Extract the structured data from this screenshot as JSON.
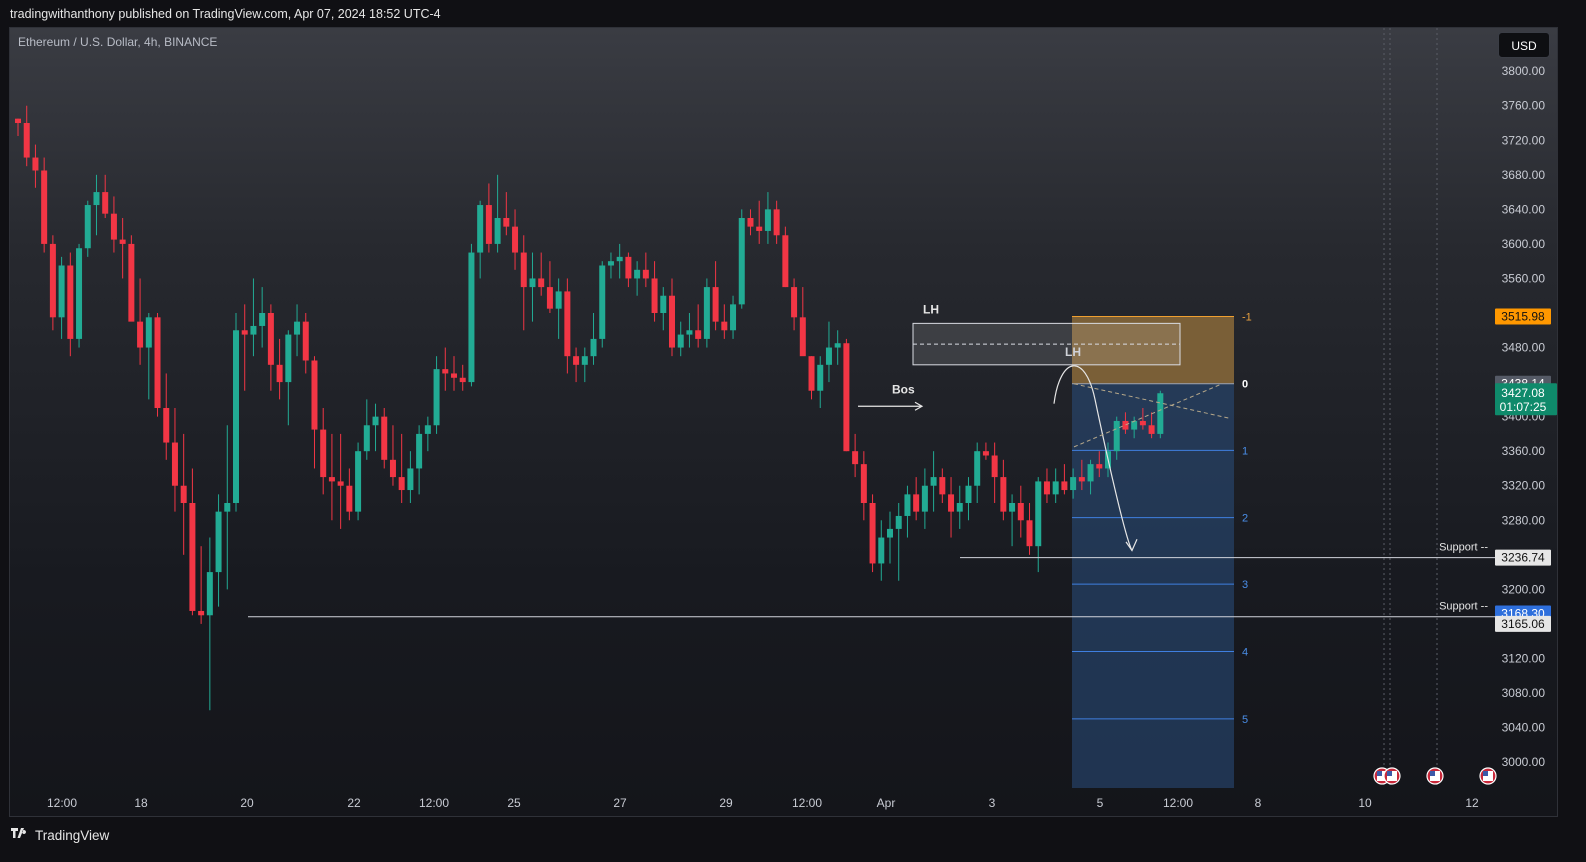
{
  "header": {
    "publish_line": "tradingwithanthony published on TradingView.com, Apr 07, 2024 18:52 UTC-4"
  },
  "chart": {
    "symbol_line": "Ethereum / U.S. Dollar, 4h, BINANCE",
    "currency_label": "USD",
    "colors": {
      "up": "#22ab94",
      "down": "#f23645",
      "support_line": "#d1d4dc",
      "target_zone": "#8a6a3a",
      "stop_zone": "#2a4e7e",
      "fib_line": "#3f7fe0",
      "price_tag_up": "#0f8a6b",
      "price_tag_blue": "#2e6fdc",
      "price_tag_orange": "#ff9800"
    }
  },
  "chart_data": {
    "type": "candlestick",
    "title": "Ethereum / U.S. Dollar, 4h, BINANCE",
    "ylim": [
      2970,
      3850
    ],
    "y_ticks": [
      "3000.00",
      "3040.00",
      "3080.00",
      "3120.00",
      "3160.00",
      "3200.00",
      "3240.00",
      "3280.00",
      "3320.00",
      "3360.00",
      "3400.00",
      "3440.00",
      "3480.00",
      "3520.00",
      "3560.00",
      "3600.00",
      "3640.00",
      "3680.00",
      "3720.00",
      "3760.00",
      "3800.00"
    ],
    "x_ticks": [
      "12:00",
      "18",
      "20",
      "22",
      "12:00",
      "25",
      "27",
      "29",
      "12:00",
      "Apr",
      "3",
      "5",
      "12:00",
      "8",
      "10",
      "12"
    ],
    "ohlc": [
      [
        3745,
        3745,
        3725,
        3740
      ],
      [
        3740,
        3760,
        3690,
        3700
      ],
      [
        3700,
        3715,
        3665,
        3685
      ],
      [
        3685,
        3700,
        3590,
        3600
      ],
      [
        3600,
        3610,
        3500,
        3515
      ],
      [
        3515,
        3585,
        3490,
        3575
      ],
      [
        3575,
        3590,
        3470,
        3490
      ],
      [
        3490,
        3600,
        3480,
        3595
      ],
      [
        3595,
        3650,
        3585,
        3645
      ],
      [
        3645,
        3680,
        3610,
        3660
      ],
      [
        3660,
        3680,
        3630,
        3635
      ],
      [
        3635,
        3655,
        3590,
        3605
      ],
      [
        3605,
        3630,
        3560,
        3600
      ],
      [
        3600,
        3610,
        3520,
        3510
      ],
      [
        3510,
        3560,
        3460,
        3480
      ],
      [
        3480,
        3520,
        3420,
        3515
      ],
      [
        3515,
        3520,
        3400,
        3410
      ],
      [
        3410,
        3450,
        3350,
        3370
      ],
      [
        3370,
        3410,
        3290,
        3320
      ],
      [
        3320,
        3380,
        3240,
        3300
      ],
      [
        3300,
        3340,
        3170,
        3175
      ],
      [
        3175,
        3250,
        3160,
        3170
      ],
      [
        3170,
        3260,
        3060,
        3220
      ],
      [
        3220,
        3310,
        3180,
        3290
      ],
      [
        3290,
        3390,
        3200,
        3300
      ],
      [
        3300,
        3520,
        3290,
        3500
      ],
      [
        3500,
        3530,
        3430,
        3495
      ],
      [
        3495,
        3560,
        3470,
        3505
      ],
      [
        3505,
        3550,
        3480,
        3520
      ],
      [
        3520,
        3530,
        3430,
        3460
      ],
      [
        3460,
        3490,
        3420,
        3440
      ],
      [
        3440,
        3500,
        3390,
        3495
      ],
      [
        3495,
        3530,
        3470,
        3510
      ],
      [
        3510,
        3520,
        3450,
        3465
      ],
      [
        3465,
        3470,
        3340,
        3385
      ],
      [
        3385,
        3410,
        3310,
        3330
      ],
      [
        3330,
        3380,
        3280,
        3325
      ],
      [
        3325,
        3380,
        3270,
        3320
      ],
      [
        3320,
        3340,
        3280,
        3290
      ],
      [
        3290,
        3370,
        3280,
        3360
      ],
      [
        3360,
        3420,
        3350,
        3390
      ],
      [
        3390,
        3415,
        3360,
        3400
      ],
      [
        3400,
        3410,
        3340,
        3350
      ],
      [
        3350,
        3390,
        3320,
        3330
      ],
      [
        3330,
        3380,
        3300,
        3315
      ],
      [
        3315,
        3360,
        3300,
        3340
      ],
      [
        3340,
        3390,
        3310,
        3380
      ],
      [
        3380,
        3400,
        3360,
        3390
      ],
      [
        3390,
        3470,
        3380,
        3455
      ],
      [
        3455,
        3480,
        3430,
        3450
      ],
      [
        3450,
        3470,
        3430,
        3445
      ],
      [
        3445,
        3460,
        3430,
        3440
      ],
      [
        3440,
        3600,
        3435,
        3590
      ],
      [
        3590,
        3650,
        3560,
        3645
      ],
      [
        3645,
        3670,
        3590,
        3600
      ],
      [
        3600,
        3680,
        3590,
        3630
      ],
      [
        3630,
        3660,
        3610,
        3620
      ],
      [
        3620,
        3640,
        3570,
        3590
      ],
      [
        3590,
        3610,
        3500,
        3550
      ],
      [
        3550,
        3590,
        3510,
        3560
      ],
      [
        3560,
        3590,
        3540,
        3550
      ],
      [
        3550,
        3580,
        3520,
        3525
      ],
      [
        3525,
        3560,
        3490,
        3545
      ],
      [
        3545,
        3560,
        3450,
        3470
      ],
      [
        3470,
        3480,
        3440,
        3460
      ],
      [
        3460,
        3480,
        3440,
        3470
      ],
      [
        3470,
        3520,
        3460,
        3490
      ],
      [
        3490,
        3580,
        3480,
        3575
      ],
      [
        3575,
        3590,
        3560,
        3580
      ],
      [
        3580,
        3600,
        3560,
        3585
      ],
      [
        3585,
        3590,
        3550,
        3560
      ],
      [
        3560,
        3580,
        3540,
        3570
      ],
      [
        3570,
        3590,
        3550,
        3560
      ],
      [
        3560,
        3580,
        3510,
        3520
      ],
      [
        3520,
        3550,
        3500,
        3540
      ],
      [
        3540,
        3560,
        3470,
        3480
      ],
      [
        3480,
        3510,
        3470,
        3495
      ],
      [
        3495,
        3520,
        3480,
        3500
      ],
      [
        3500,
        3530,
        3480,
        3490
      ],
      [
        3490,
        3560,
        3480,
        3550
      ],
      [
        3550,
        3580,
        3500,
        3510
      ],
      [
        3510,
        3530,
        3490,
        3500
      ],
      [
        3500,
        3540,
        3490,
        3530
      ],
      [
        3530,
        3640,
        3525,
        3630
      ],
      [
        3630,
        3640,
        3610,
        3620
      ],
      [
        3620,
        3650,
        3600,
        3615
      ],
      [
        3615,
        3660,
        3600,
        3640
      ],
      [
        3640,
        3650,
        3600,
        3610
      ],
      [
        3610,
        3620,
        3550,
        3550
      ],
      [
        3550,
        3560,
        3500,
        3515
      ],
      [
        3515,
        3550,
        3480,
        3470
      ],
      [
        3470,
        3470,
        3420,
        3430
      ],
      [
        3430,
        3470,
        3410,
        3460
      ],
      [
        3460,
        3510,
        3440,
        3480
      ],
      [
        3480,
        3500,
        3460,
        3485
      ],
      [
        3485,
        3490,
        3360,
        3360
      ],
      [
        3360,
        3380,
        3330,
        3345
      ],
      [
        3345,
        3360,
        3280,
        3300
      ],
      [
        3300,
        3310,
        3220,
        3230
      ],
      [
        3230,
        3280,
        3210,
        3260
      ],
      [
        3260,
        3290,
        3230,
        3270
      ],
      [
        3270,
        3300,
        3210,
        3285
      ],
      [
        3285,
        3320,
        3260,
        3310
      ],
      [
        3310,
        3330,
        3280,
        3290
      ],
      [
        3290,
        3340,
        3270,
        3320
      ],
      [
        3320,
        3360,
        3290,
        3330
      ],
      [
        3330,
        3340,
        3300,
        3310
      ],
      [
        3310,
        3330,
        3260,
        3290
      ],
      [
        3290,
        3320,
        3270,
        3300
      ],
      [
        3300,
        3330,
        3280,
        3320
      ],
      [
        3320,
        3370,
        3300,
        3360
      ],
      [
        3360,
        3370,
        3350,
        3355
      ],
      [
        3355,
        3370,
        3300,
        3330
      ],
      [
        3330,
        3350,
        3280,
        3290
      ],
      [
        3290,
        3310,
        3250,
        3300
      ],
      [
        3300,
        3320,
        3260,
        3280
      ],
      [
        3280,
        3300,
        3240,
        3250
      ],
      [
        3250,
        3330,
        3220,
        3325
      ],
      [
        3325,
        3340,
        3300,
        3310
      ],
      [
        3310,
        3340,
        3300,
        3325
      ],
      [
        3325,
        3345,
        3310,
        3315
      ],
      [
        3315,
        3340,
        3305,
        3330
      ],
      [
        3330,
        3350,
        3315,
        3325
      ],
      [
        3325,
        3350,
        3310,
        3345
      ],
      [
        3345,
        3360,
        3330,
        3340
      ],
      [
        3340,
        3370,
        3330,
        3360
      ],
      [
        3360,
        3400,
        3350,
        3395
      ],
      [
        3395,
        3405,
        3380,
        3385
      ],
      [
        3385,
        3400,
        3375,
        3395
      ],
      [
        3395,
        3410,
        3385,
        3390
      ],
      [
        3390,
        3405,
        3375,
        3380
      ],
      [
        3380,
        3430,
        3375,
        3427.08
      ]
    ],
    "annotations": {
      "lh_left": "LH",
      "lh_right": "LH",
      "bos": "Bos",
      "support_label_1": "Support --",
      "support_label_2": "Support --",
      "fib_levels": [
        {
          "label": "-1",
          "price": 3515.98
        },
        {
          "label": "0",
          "price": 3438.14
        },
        {
          "label": "1",
          "price": 3361
        },
        {
          "label": "2",
          "price": 3283
        },
        {
          "label": "3",
          "price": 3206
        },
        {
          "label": "4",
          "price": 3128
        },
        {
          "label": "5",
          "price": 3050
        }
      ],
      "support_1": 3236.74,
      "support_2": 3168.3
    },
    "price_tags": {
      "tag_3515": "3515.98",
      "tag_3438": "3438.14",
      "tag_3427": "3427.08",
      "tag_countdown": "01:07:25",
      "tag_3236": "3236.74",
      "tag_3168": "3168.30",
      "tag_3165": "3165.06"
    }
  },
  "footer": {
    "brand": "TradingView"
  }
}
